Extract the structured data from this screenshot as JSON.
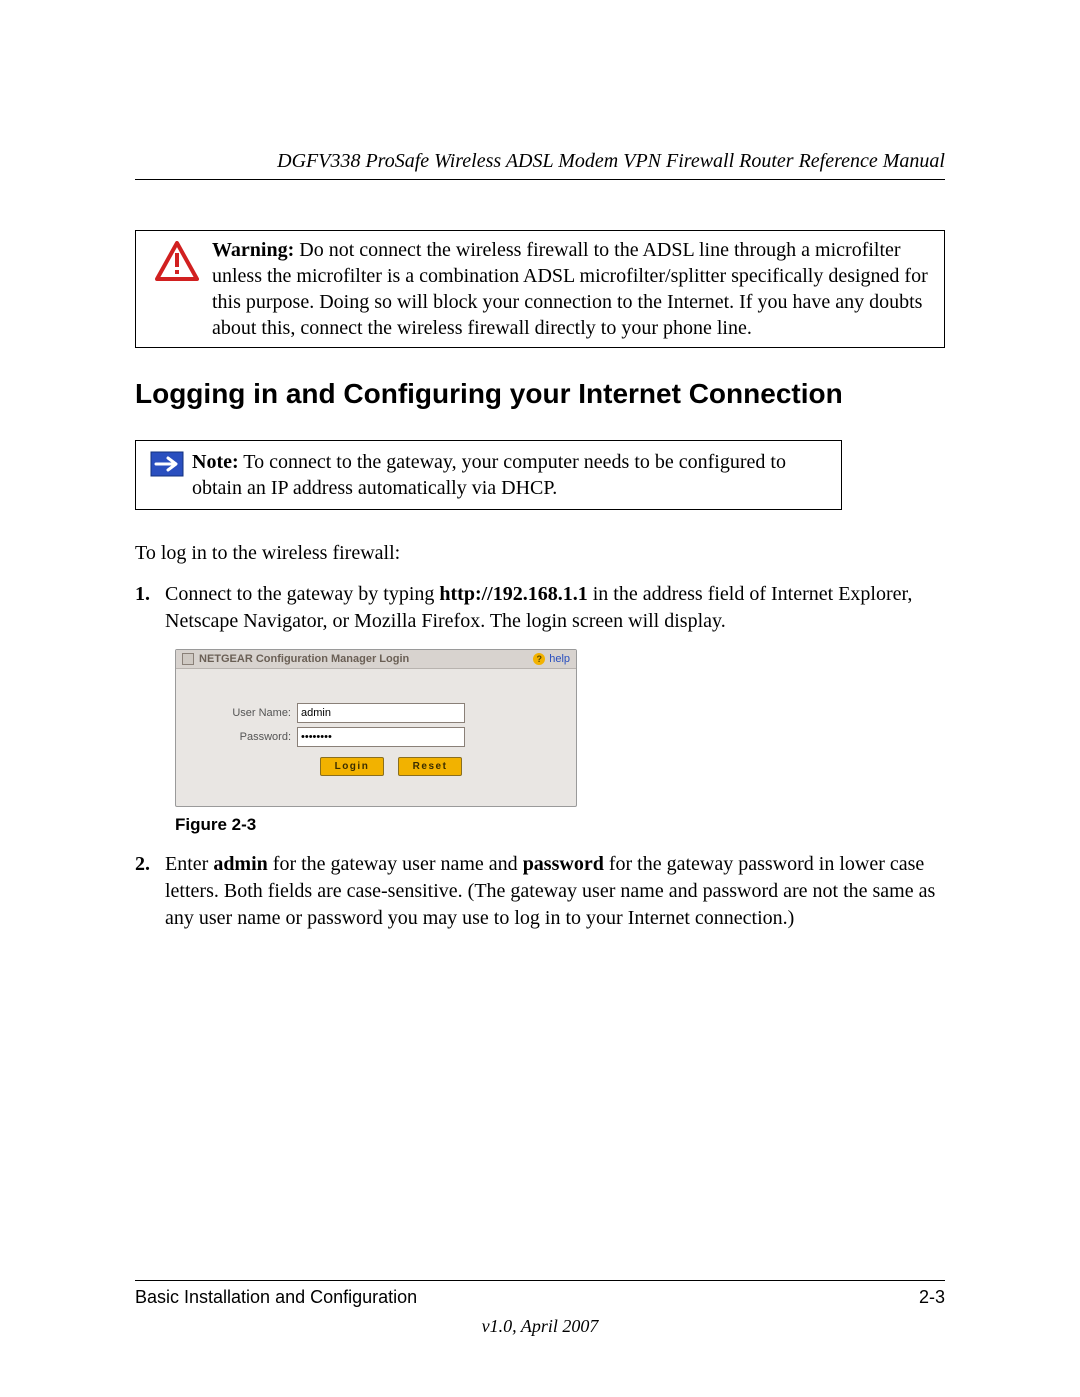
{
  "header": {
    "running_title": "DGFV338 ProSafe Wireless ADSL Modem VPN Firewall Router Reference Manual"
  },
  "warning": {
    "lead": "Warning:",
    "text": " Do not connect the wireless firewall to the ADSL line through a microfilter unless the microfilter is a combination ADSL microfilter/splitter specifically designed for this purpose. Doing so will block your connection to the Internet. If you have any doubts about this, connect the wireless firewall directly to your phone line."
  },
  "section": {
    "heading": "Logging in and Configuring your Internet Connection"
  },
  "note": {
    "lead": "Note:",
    "text": " To connect to the gateway, your computer needs to be configured to obtain an IP address automatically via DHCP."
  },
  "intro": "To log in to the wireless firewall:",
  "steps": {
    "s1": {
      "num": "1.",
      "pre": "Connect to the gateway by typing ",
      "bold1": "http://192.168.1.1",
      "post": " in the address field of Internet Explorer, Netscape Navigator, or Mozilla Firefox. The login screen will display."
    },
    "s2": {
      "num": "2.",
      "pre": "Enter ",
      "bold1": "admin",
      "mid1": " for the gateway user name and ",
      "bold2": "password",
      "post": " for the gateway password in lower case letters. Both fields are case-sensitive. (The gateway user name and password are not the same as any user name or password you may use to log in to your Internet connection.)"
    }
  },
  "login_screenshot": {
    "title": "NETGEAR Configuration Manager Login",
    "help_label": "help",
    "username_label": "User Name:",
    "username_value": "admin",
    "password_label": "Password:",
    "password_value": "••••••••",
    "login_btn": "Login",
    "reset_btn": "Reset"
  },
  "figure_caption": "Figure 2-3",
  "footer": {
    "left": "Basic Installation and Configuration",
    "right": "2-3",
    "version": "v1.0, April 2007"
  }
}
